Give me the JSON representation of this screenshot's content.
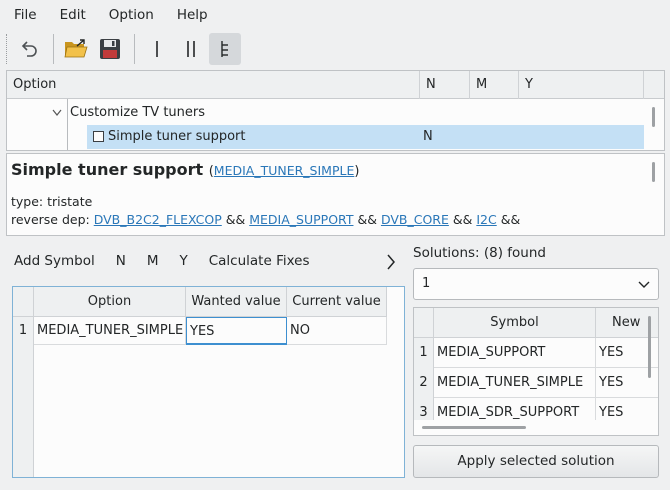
{
  "menubar": {
    "items": [
      "File",
      "Edit",
      "Option",
      "Help"
    ]
  },
  "toolbar": {
    "buttons": [
      "undo-icon",
      "open-folder-icon",
      "save-icon",
      "single-view-icon",
      "split-view-icon",
      "full-view-icon"
    ],
    "active": "full-view-icon"
  },
  "tree": {
    "columns": [
      "Option",
      "N",
      "M",
      "Y"
    ],
    "rows": [
      {
        "label": "Customize TV tuners",
        "n": "",
        "expanded": true
      },
      {
        "label": "Simple tuner support",
        "n": "N",
        "selected": true
      }
    ]
  },
  "info": {
    "title": "Simple tuner support",
    "symbol": "MEDIA_TUNER_SIMPLE",
    "type_line": "type: tristate",
    "revdep_label": "reverse dep:",
    "revdep_items": [
      "DVB_B2C2_FLEXCOP",
      "MEDIA_SUPPORT",
      "DVB_CORE",
      "I2C"
    ],
    "revdep_sep": "&&"
  },
  "fixbar": {
    "add_symbol": "Add Symbol",
    "n": "N",
    "m": "M",
    "y": "Y",
    "calculate": "Calculate Fixes",
    "toggle_icon": "chevron-right-icon"
  },
  "conflicts": {
    "headers": [
      "Option",
      "Wanted value",
      "Current value"
    ],
    "rows": [
      {
        "num": "1",
        "option": "MEDIA_TUNER_SIMPLE",
        "wanted": "YES",
        "current": "NO"
      }
    ]
  },
  "solutions": {
    "label": "Solutions: (8) found",
    "selected": "1",
    "headers": [
      "Symbol",
      "New"
    ],
    "rows": [
      {
        "num": "1",
        "symbol": "MEDIA_SUPPORT",
        "new": "YES"
      },
      {
        "num": "2",
        "symbol": "MEDIA_TUNER_SIMPLE",
        "new": "YES"
      },
      {
        "num": "3",
        "symbol": "MEDIA_SDR_SUPPORT",
        "new": "YES"
      }
    ],
    "apply_label": "Apply selected solution"
  },
  "colors": {
    "selection": "#c4e0f5",
    "link": "#2a77b8",
    "focus_border": "#7fb2d6"
  }
}
